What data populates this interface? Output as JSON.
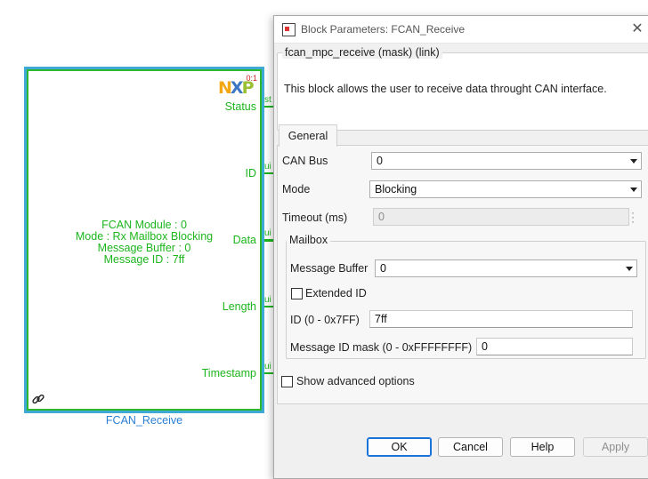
{
  "block": {
    "sample_time": "0:1",
    "info_lines": [
      "FCAN Module : 0",
      "Mode : Rx Mailbox Blocking",
      "Message Buffer : 0",
      "Message ID : 7ff"
    ],
    "ports": [
      {
        "label": "Status",
        "type": "st"
      },
      {
        "label": "ID",
        "type": "ui"
      },
      {
        "label": "Data",
        "type": "ui"
      },
      {
        "label": "Length",
        "type": "ui"
      },
      {
        "label": "Timestamp",
        "type": "ui"
      }
    ],
    "name": "FCAN_Receive",
    "logo": "NXP",
    "colors": {
      "block_border": "#2db82d",
      "selection": "#3fa9d6",
      "text": "#1db51d",
      "name": "#2a7fd4"
    }
  },
  "dialog": {
    "title": "Block Parameters: FCAN_Receive",
    "mask_header": "fcan_mpc_receive (mask) (link)",
    "description": "This block allows the user to receive data throught CAN interface.",
    "tab": "General",
    "fields": {
      "can_bus": {
        "label": "CAN Bus",
        "value": "0"
      },
      "mode": {
        "label": "Mode",
        "value": "Blocking"
      },
      "timeout": {
        "label": "Timeout (ms)",
        "value": "0"
      }
    },
    "mailbox": {
      "legend": "Mailbox",
      "message_buffer": {
        "label": "Message Buffer",
        "value": "0"
      },
      "extended_id": {
        "label": "Extended ID",
        "checked": false
      },
      "id": {
        "label": "ID (0 - 0x7FF)",
        "value": "7ff"
      },
      "id_mask": {
        "label": "Message ID mask (0 - 0xFFFFFFFF)",
        "value": "0"
      }
    },
    "show_advanced": {
      "label": "Show advanced options",
      "checked": false
    },
    "buttons": {
      "ok": "OK",
      "cancel": "Cancel",
      "help": "Help",
      "apply": "Apply"
    },
    "icons": {
      "close": "close-icon",
      "title": "simulink-block-icon",
      "dropdown": "chevron-down-icon"
    }
  }
}
